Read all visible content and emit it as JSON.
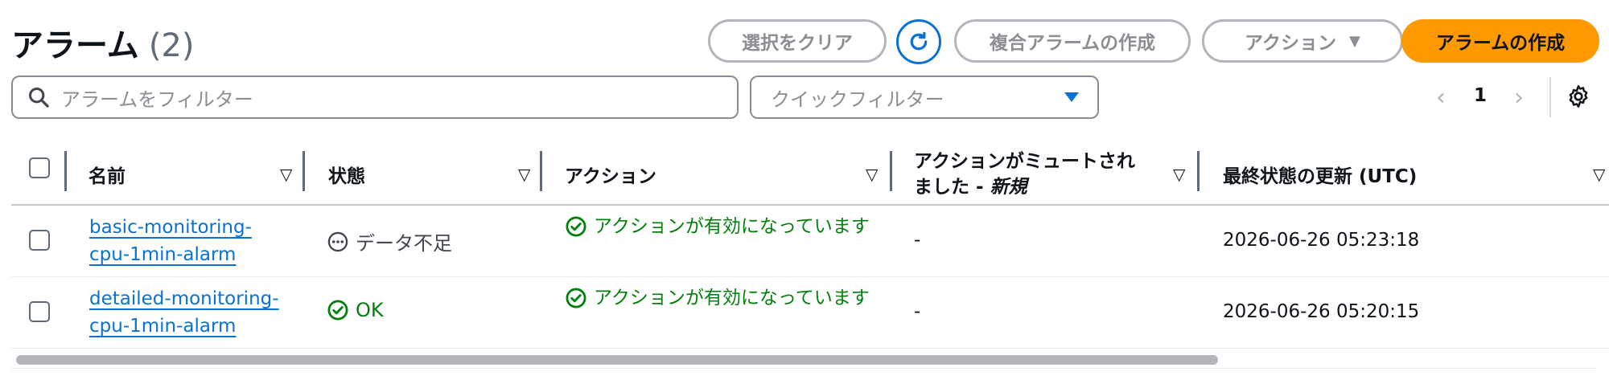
{
  "header": {
    "title": "アラーム",
    "count": "(2)"
  },
  "toolbar": {
    "clear_label": "選択をクリア",
    "composite_label": "複合アラームの作成",
    "actions_label": "アクション",
    "create_label": "アラームの作成",
    "refresh_icon": "refresh-icon"
  },
  "filter": {
    "search_placeholder": "アラームをフィルター",
    "quick_placeholder": "クイックフィルター"
  },
  "pager": {
    "page": "1"
  },
  "table": {
    "columns": {
      "name": "名前",
      "state": "状態",
      "actions": "アクション",
      "muted_line1": "アクションがミュートされ",
      "muted_line2_prefix": "ました - ",
      "muted_line2_new": "新規",
      "updated": "最終状態の更新 (UTC)"
    },
    "rows": [
      {
        "name_line1": "basic-monitoring-",
        "name_line2": "cpu-1min-alarm",
        "state": "データ不足",
        "state_icon": "insufficient-data-icon",
        "action_status": "アクションが有効になっています",
        "muted": "-",
        "updated": "2026-06-26 05:23:18"
      },
      {
        "name_line1": "detailed-monitoring-",
        "name_line2": "cpu-1min-alarm",
        "state": "OK",
        "state_icon": "ok-icon",
        "action_status": "アクションが有効になっています",
        "muted": "-",
        "updated": "2026-06-26 05:20:15"
      }
    ]
  },
  "colors": {
    "primary": "#ff9900",
    "link": "#0972d3",
    "success": "#037f0c",
    "disabled": "#8d8d94"
  }
}
